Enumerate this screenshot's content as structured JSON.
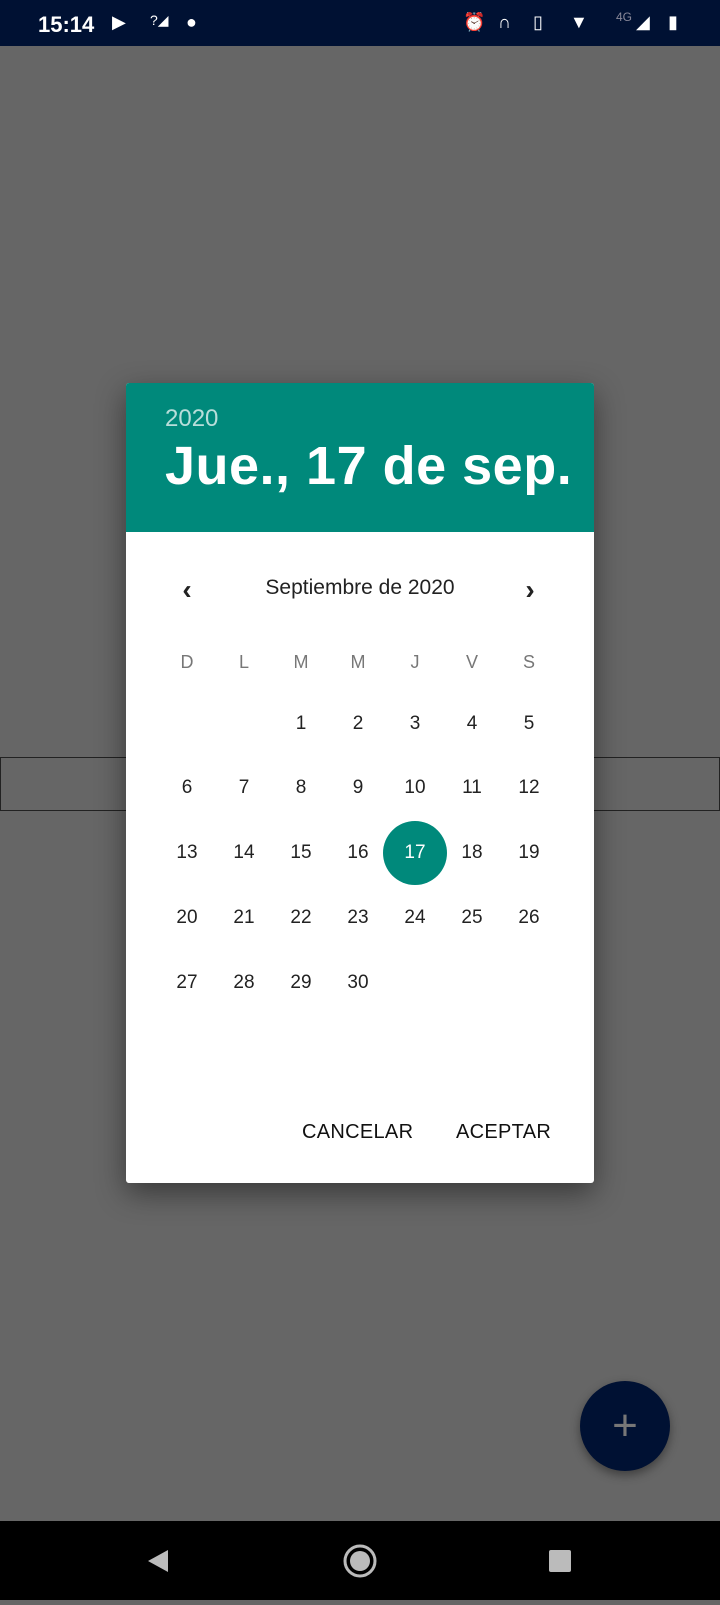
{
  "status_bar": {
    "time": "15:14",
    "network": "4G"
  },
  "dialog": {
    "year": "2020",
    "selected_date": "Jue., 17 de sep.",
    "month_label": "Septiembre de 2020",
    "weekdays": [
      "D",
      "L",
      "M",
      "M",
      "J",
      "V",
      "S"
    ],
    "first_weekday_index": 2,
    "days": [
      "1",
      "2",
      "3",
      "4",
      "5",
      "6",
      "7",
      "8",
      "9",
      "10",
      "11",
      "12",
      "13",
      "14",
      "15",
      "16",
      "17",
      "18",
      "19",
      "20",
      "21",
      "22",
      "23",
      "24",
      "25",
      "26",
      "27",
      "28",
      "29",
      "30"
    ],
    "selected_day": "17",
    "cancel_label": "CANCELAR",
    "accept_label": "ACEPTAR"
  },
  "colors": {
    "accent": "#00897b",
    "status_bar": "#001133"
  }
}
